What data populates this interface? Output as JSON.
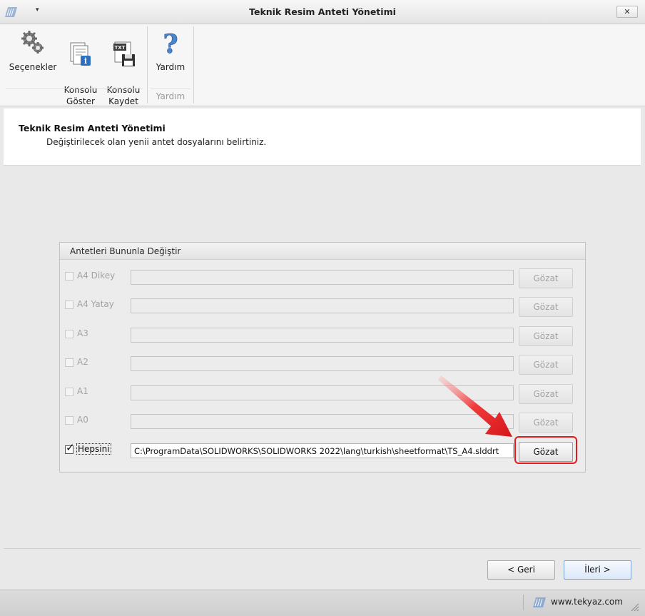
{
  "window": {
    "title": "Teknik Resim Anteti Yönetimi",
    "qat_arrow": "▾",
    "close_glyph": "✕"
  },
  "ribbon": {
    "buttons": [
      {
        "label": "Seçenekler",
        "icon": "gears-icon"
      },
      {
        "label": "Konsolu\nGöster",
        "icon": "console-info-icon"
      },
      {
        "label": "Konsolu\nKaydet",
        "icon": "txt-save-icon"
      },
      {
        "label": "Yardım",
        "icon": "help-question-icon"
      }
    ],
    "group_help_label": "Yardım"
  },
  "header": {
    "title": "Teknik Resim Anteti Yönetimi",
    "subtitle": "Değiştirilecek olan yenii antet dosyalarını belirtiniz."
  },
  "groupbox": {
    "title": "Antetleri Bununla Değiştir",
    "rows": [
      {
        "label": "A4 Dikey",
        "checked": false,
        "path": "",
        "browse": "Gözat",
        "enabled": false
      },
      {
        "label": "A4 Yatay",
        "checked": false,
        "path": "",
        "browse": "Gözat",
        "enabled": false
      },
      {
        "label": "A3",
        "checked": false,
        "path": "",
        "browse": "Gözat",
        "enabled": false
      },
      {
        "label": "A2",
        "checked": false,
        "path": "",
        "browse": "Gözat",
        "enabled": false
      },
      {
        "label": "A1",
        "checked": false,
        "path": "",
        "browse": "Gözat",
        "enabled": false
      },
      {
        "label": "A0",
        "checked": false,
        "path": "",
        "browse": "Gözat",
        "enabled": false
      },
      {
        "label": "Hepsini",
        "checked": true,
        "path": "C:\\ProgramData\\SOLIDWORKS\\SOLIDWORKS 2022\\lang\\turkish\\sheetformat\\TS_A4.slddrt",
        "browse": "Gözat",
        "enabled": true
      }
    ]
  },
  "nav": {
    "back_label": "< Geri",
    "next_label": "İleri >"
  },
  "statusbar": {
    "website": "www.tekyaz.com"
  },
  "colors": {
    "highlight": "#e5181a",
    "arrow": "#e0191c",
    "accent_blue": "#2f6fc0"
  }
}
